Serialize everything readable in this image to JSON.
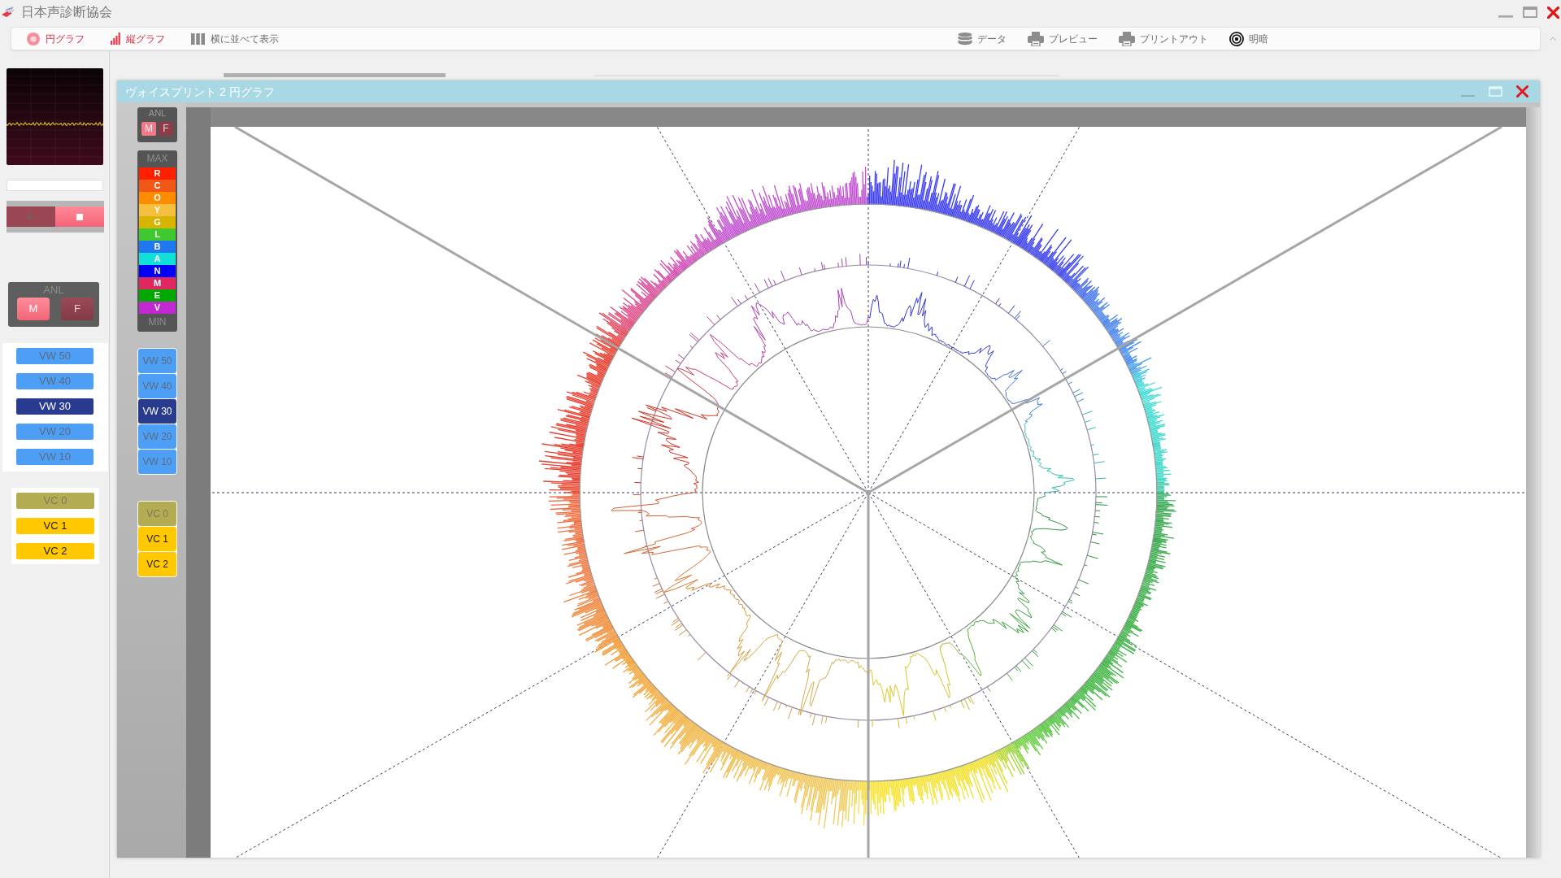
{
  "window": {
    "title": "日本声診断協会"
  },
  "toolbar": {
    "left": [
      {
        "label": "円グラフ",
        "kind": "pie",
        "active": true
      },
      {
        "label": "縦グラフ",
        "kind": "bars",
        "active": true
      },
      {
        "label": "横に並べて表示",
        "kind": "columns",
        "active": false
      }
    ],
    "right": [
      {
        "label": "データ",
        "kind": "database"
      },
      {
        "label": "プレビュー",
        "kind": "printer"
      },
      {
        "label": "プリントアウト",
        "kind": "printer"
      },
      {
        "label": "明暗",
        "kind": "contrast"
      }
    ]
  },
  "sidebar": {
    "transport": [
      {
        "kind": "play",
        "selected": false
      },
      {
        "kind": "stop",
        "selected": true
      }
    ],
    "anl": {
      "label": "ANL",
      "buttons": [
        {
          "label": "M",
          "selected": true
        },
        {
          "label": "F",
          "selected": false
        }
      ]
    },
    "vw_buttons": [
      {
        "label": "VW 50",
        "selected": false
      },
      {
        "label": "VW 40",
        "selected": false
      },
      {
        "label": "VW 30",
        "selected": true
      },
      {
        "label": "VW 20",
        "selected": false
      },
      {
        "label": "VW 10",
        "selected": false
      }
    ],
    "vc_buttons": [
      {
        "label": "VC 0",
        "selected": true
      },
      {
        "label": "VC 1",
        "selected": false
      },
      {
        "label": "VC 2",
        "selected": false
      }
    ]
  },
  "voiceprint_window": {
    "title": "ヴォイスプリント 2 円グラフ",
    "anl": {
      "label": "ANL",
      "buttons": [
        {
          "label": "M",
          "selected": true
        },
        {
          "label": "F",
          "selected": false
        }
      ]
    },
    "color_scale": {
      "max_label": "MAX",
      "min_label": "MIN",
      "bands": [
        {
          "label": "R",
          "color": "#ff2000"
        },
        {
          "label": "C",
          "color": "#f05818"
        },
        {
          "label": "O",
          "color": "#ff8c00"
        },
        {
          "label": "Y",
          "color": "#f5c040"
        },
        {
          "label": "G",
          "color": "#d8b400"
        },
        {
          "label": "L",
          "color": "#40c830"
        },
        {
          "label": "B",
          "color": "#2078f0"
        },
        {
          "label": "A",
          "color": "#10e0d8"
        },
        {
          "label": "N",
          "color": "#0000f8"
        },
        {
          "label": "M",
          "color": "#e02860"
        },
        {
          "label": "E",
          "color": "#00a800"
        },
        {
          "label": "V",
          "color": "#c028d0"
        }
      ]
    },
    "vw_buttons": [
      {
        "label": "VW 50",
        "selected": false
      },
      {
        "label": "VW 40",
        "selected": false
      },
      {
        "label": "VW 30",
        "selected": true
      },
      {
        "label": "VW 20",
        "selected": false
      },
      {
        "label": "VW 10",
        "selected": false
      }
    ],
    "vc_buttons": [
      {
        "label": "VC 0",
        "selected": true
      },
      {
        "label": "VC 1",
        "selected": false
      },
      {
        "label": "VC 2",
        "selected": false
      }
    ]
  }
}
